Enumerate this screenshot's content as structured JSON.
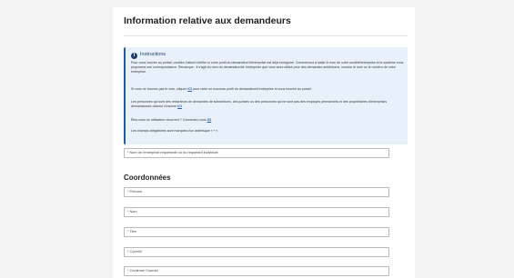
{
  "page": {
    "title": "Information relative aux demandeurs",
    "section_title": "Coordonnées",
    "asterisk": "*"
  },
  "instructions": {
    "heading": "Instructions",
    "p1": "Pour vous inscrire au portail, veuillez d'abord vérifier si votre profil du demandeur/d'entreprise est déjà enregistré. Commencez à saisir le nom de votre société/entreprise et le système vous proposera une correspondance. Remarque : il s'agit du nom du demandeur/de l'entreprise que vous avez utilisé pour des demandes antérieures, comme le nom ou le numéro de votre entreprise.",
    "p2_before": "Si vous ne trouvez pas le nom, cliquez",
    "p2_link": "ICI",
    "p2_after": "pour créer un nouveau profil du demandeur/d'entreprise et vous inscrire au portail.",
    "p3_before": "Les personnes qui sont des rédacteurs de demandes de subventions, des juristes ou des personnes qui ne sont pas des employés permanents ni des propriétaires d'entreprises demandeuses doivent s'inscrire",
    "p3_link": "ICI",
    "p4_before": "Êtes-vous un utilisateur récurrent ? Connectez-vous",
    "p4_link": "ICI",
    "p5": "Les champs obligatoires sont marqués d'un astérisque « * »."
  },
  "fields": {
    "company": "Nom de l'entreprise requérante ou du requérant individuel",
    "first_name": "Prénom",
    "last_name": "Nom",
    "job_title": "Titre",
    "email": "Courriel",
    "confirm_email": "Confirmer Courriel"
  }
}
